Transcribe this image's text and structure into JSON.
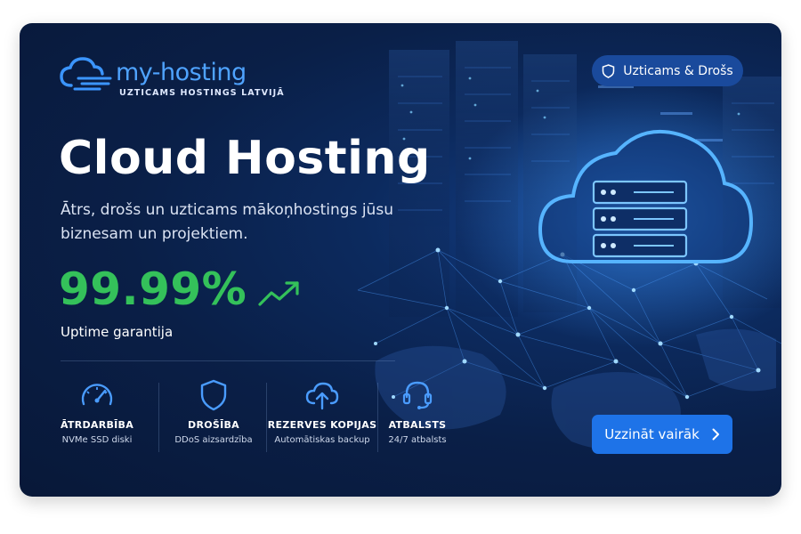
{
  "brand": {
    "name": "my-hosting",
    "tagline": "UZTICAMS HOSTINGS LATVIJĀ"
  },
  "badge": {
    "label": "Uzticams & Drošs",
    "icon": "shield-icon"
  },
  "hero": {
    "title": "Cloud Hosting",
    "subtitle": "Ātrs, drošs un uzticams mākoņhostings jūsu biznesam un projektiem."
  },
  "uptime": {
    "value": "99.99%",
    "label": "Uptime garantija",
    "icon": "trend-up-icon"
  },
  "features": [
    {
      "title": "ĀTRDARBĪBA",
      "desc": "NVMe SSD diski",
      "icon": "speedometer-icon"
    },
    {
      "title": "DROŠĪBA",
      "desc": "DDoS aizsardzība",
      "icon": "shield-icon"
    },
    {
      "title": "REZERVES KOPIJAS",
      "desc": "Automātiskas backup",
      "icon": "cloud-upload-icon"
    },
    {
      "title": "ATBALSTS",
      "desc": "24/7 atbalsts",
      "icon": "headset-icon"
    }
  ],
  "cta": {
    "label": "Uzzināt vairāk",
    "icon": "chevron-right-icon"
  },
  "colors": {
    "card_bg": "#0a1f47",
    "accent_blue": "#4fa3ff",
    "uptime_green": "#34c15a",
    "cta_blue": "#1e73e8",
    "badge_bg": "#1a4a9c"
  }
}
